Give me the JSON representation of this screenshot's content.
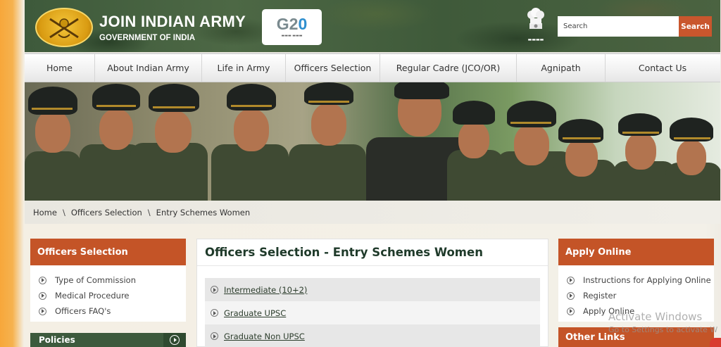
{
  "header": {
    "title": "JOIN INDIAN ARMY",
    "subtitle": "GOVERNMENT OF INDIA",
    "g20_logo_text": "G20",
    "search_placeholder": "Search",
    "search_button": "Search",
    "icons": [
      "army-emblem-icon",
      "g20-logo",
      "ashoka-emblem-icon"
    ]
  },
  "nav": {
    "items": [
      {
        "label": "Home"
      },
      {
        "label": "About Indian Army"
      },
      {
        "label": "Life in Army"
      },
      {
        "label": "Officers Selection"
      },
      {
        "label": "Regular Cadre (JCO/OR)"
      },
      {
        "label": "Agnipath"
      },
      {
        "label": "Contact Us"
      }
    ]
  },
  "breadcrumb": {
    "items": [
      "Home",
      "Officers Selection",
      "Entry Schemes Women"
    ],
    "separator": "\\"
  },
  "left_sidebar": {
    "heading": "Officers Selection",
    "items": [
      "Type of Commission",
      "Medical Procedure",
      "Officers FAQ's"
    ],
    "policies_label": "Policies"
  },
  "main": {
    "title": "Officers Selection - Entry Schemes Women",
    "schemes": [
      "Intermediate (10+2)",
      "Graduate UPSC",
      "Graduate Non UPSC"
    ]
  },
  "right_sidebar": {
    "heading": "Apply Online",
    "items": [
      "Instructions for Applying Online",
      "Register",
      "Apply Online"
    ],
    "other_links_heading": "Other Links"
  },
  "os_overlay": {
    "line1": "Activate Windows",
    "line2": "Go to Settings to activate W"
  },
  "colors": {
    "header_green": "#3e5a3b",
    "accent_orange": "#c45427",
    "policies_green": "#3d5a3d"
  }
}
